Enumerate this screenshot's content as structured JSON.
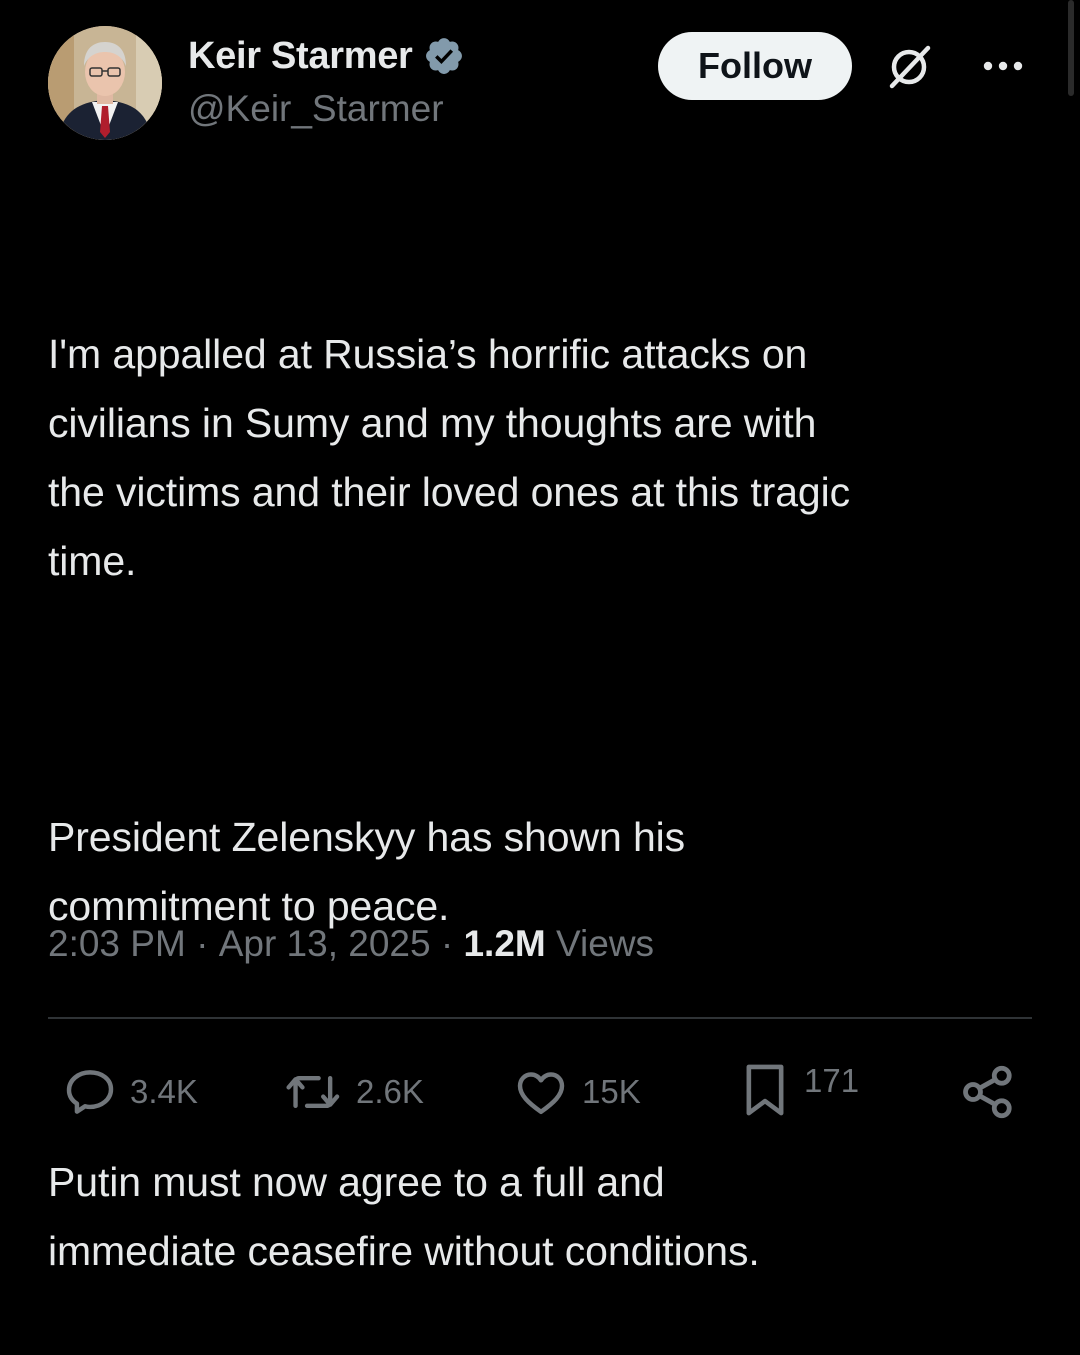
{
  "author": {
    "display_name": "Keir Starmer",
    "handle": "@Keir_Starmer",
    "verified_color": "#829aab",
    "follow_label": "Follow"
  },
  "icons": {
    "verified": "verified-badge-icon",
    "grok": "grok-icon",
    "more": "more-icon",
    "reply": "reply-icon",
    "repost": "repost-icon",
    "like": "like-icon",
    "bookmark": "bookmark-icon",
    "share": "share-icon"
  },
  "tweet": {
    "paragraphs": [
      "I'm appalled at Russia’s horrific attacks on\ncivilians in Sumy and my thoughts are with\nthe victims and their loved ones at this tragic\ntime.",
      "President Zelenskyy has shown his\ncommitment to peace.",
      "Putin must now agree to a full and\nimmediate ceasefire without conditions."
    ],
    "time": "2:03 PM",
    "date": "Apr 13, 2025",
    "separator": " · ",
    "views_count": "1.2M",
    "views_label": " Views"
  },
  "engagement": {
    "replies": "3.4K",
    "reposts": "2.6K",
    "likes": "15K",
    "bookmarks": "171"
  },
  "colors": {
    "background": "#000000",
    "text_primary": "#e7e9ea",
    "text_secondary": "#71767b",
    "divider": "#2f3336",
    "follow_bg": "#eff3f4"
  }
}
